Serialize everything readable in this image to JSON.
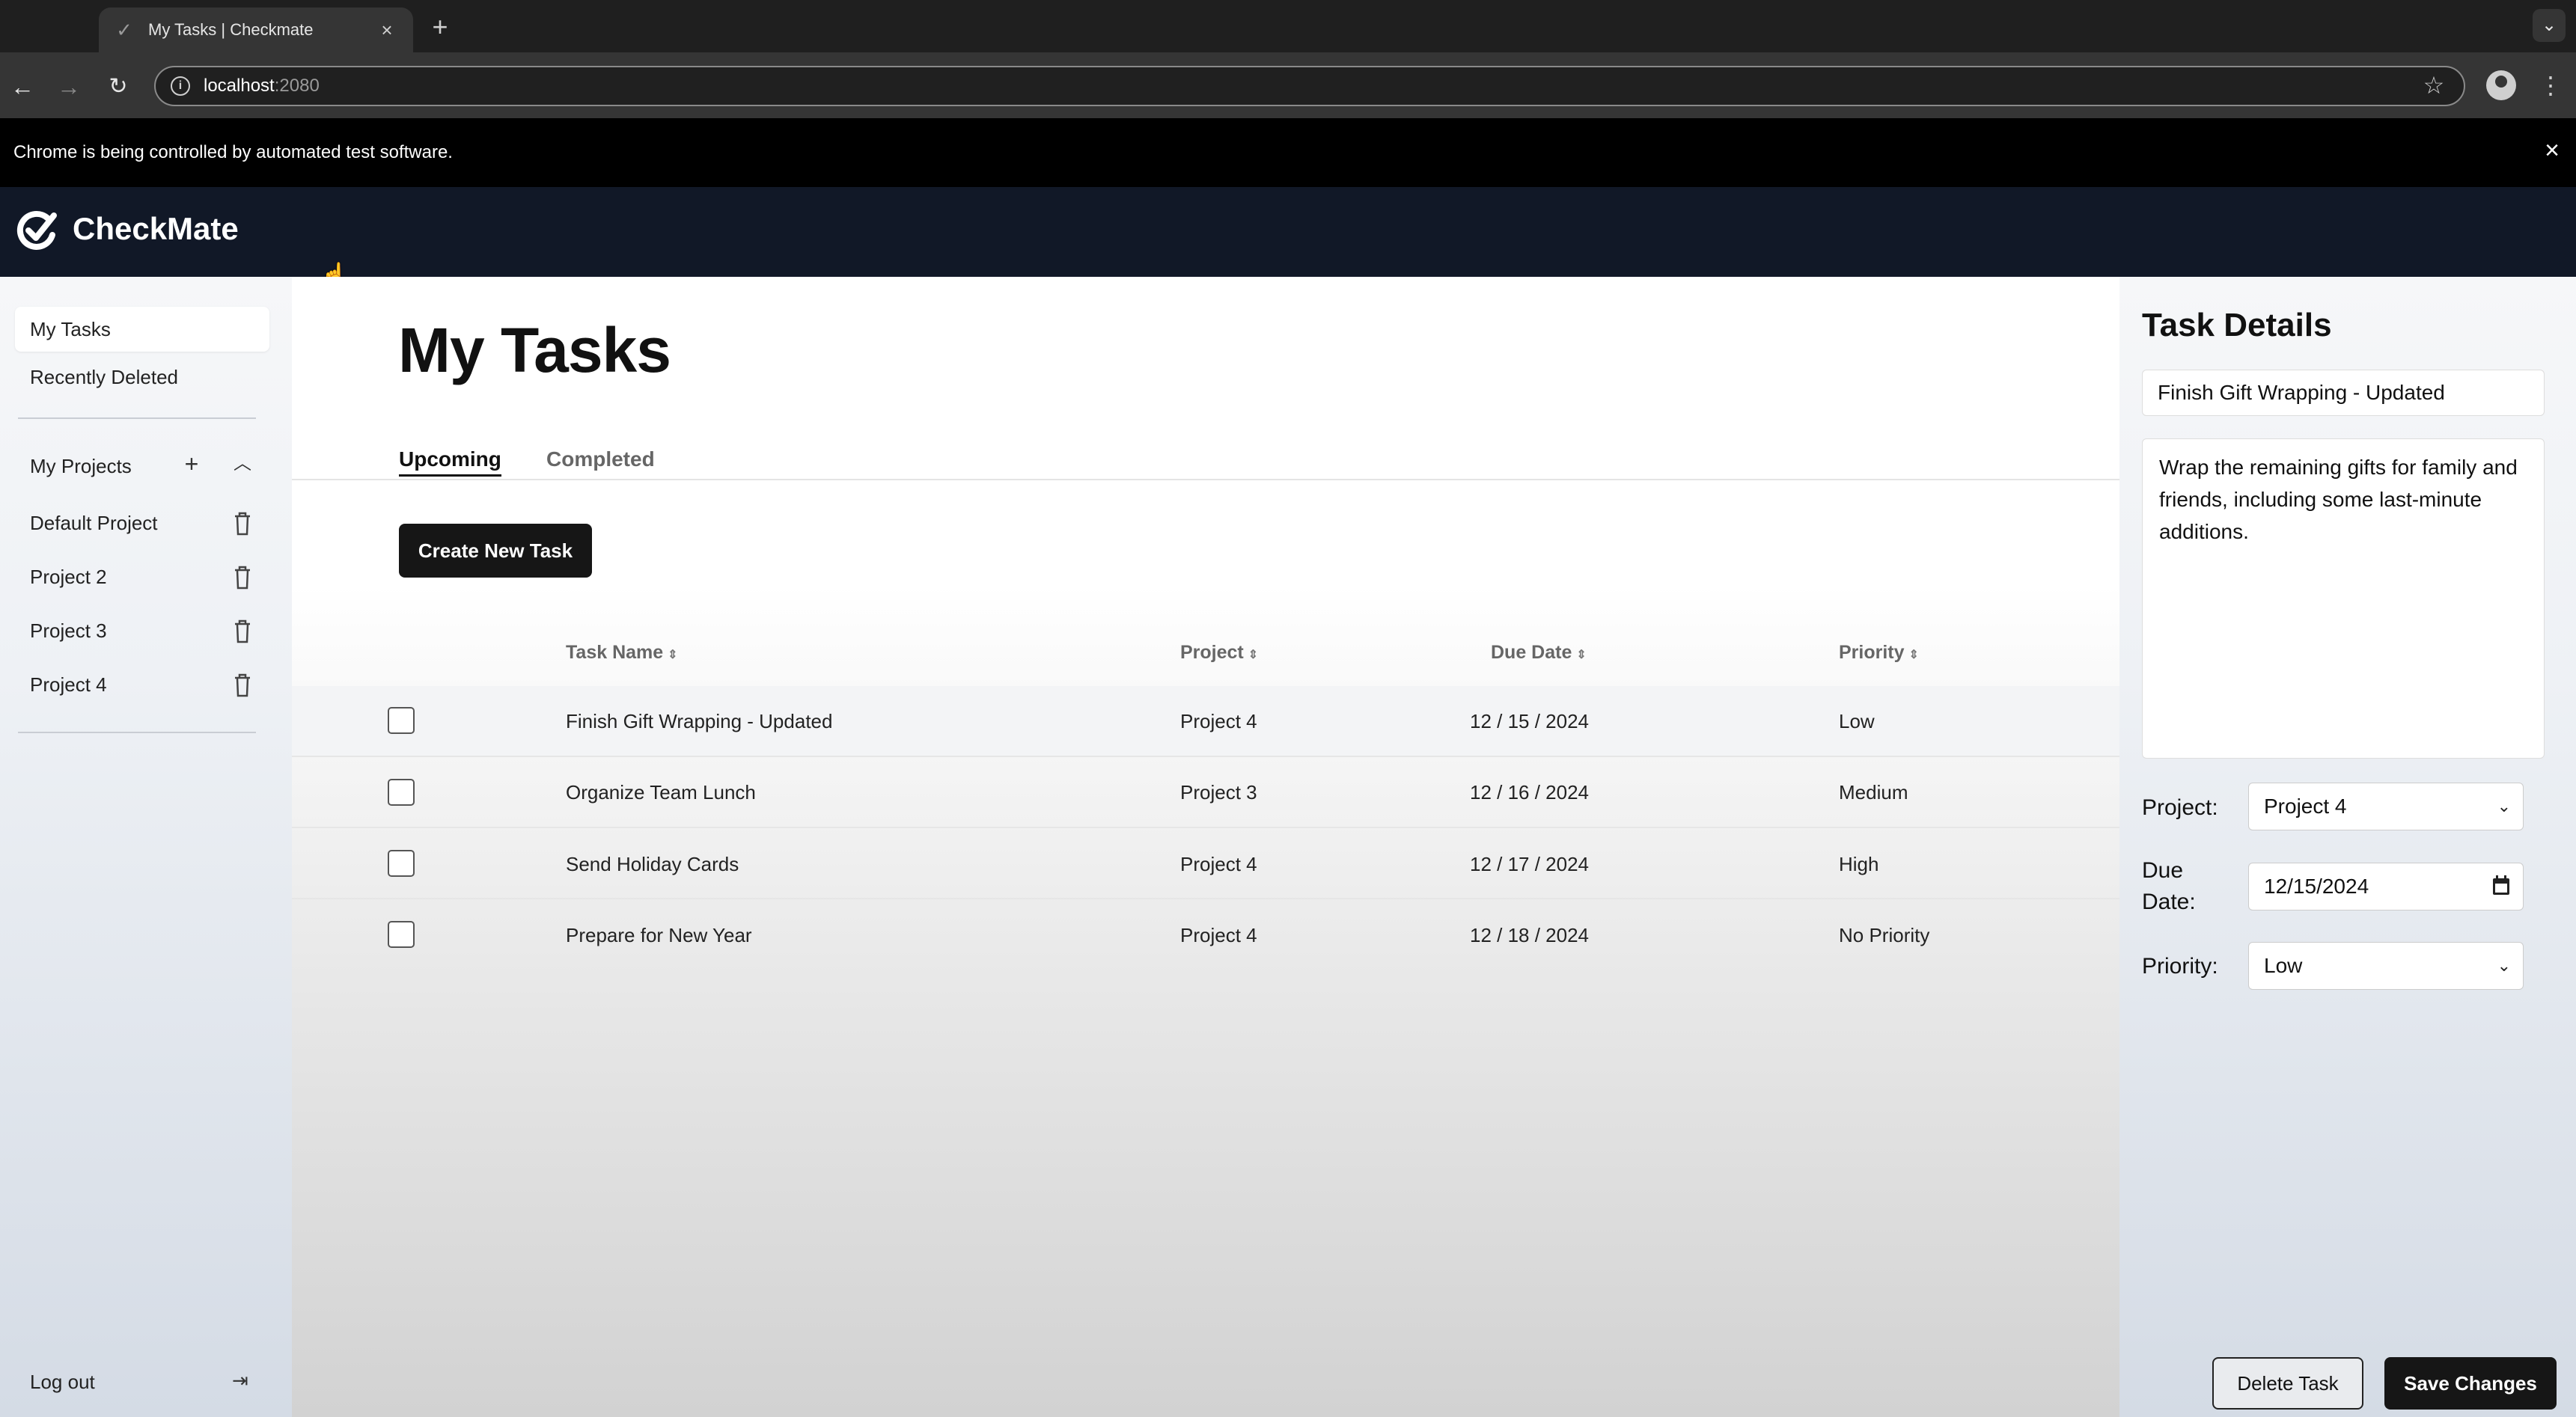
{
  "browser": {
    "tab_title": "My Tasks | Checkmate",
    "url_host": "localhost",
    "url_port": ":2080",
    "automation_notice": "Chrome is being controlled by automated test software."
  },
  "app": {
    "brand": "CheckMate"
  },
  "sidebar": {
    "nav": [
      {
        "label": "My Tasks"
      },
      {
        "label": "Recently Deleted"
      }
    ],
    "projects_heading": "My Projects",
    "projects": [
      {
        "label": "Default Project"
      },
      {
        "label": "Project 2"
      },
      {
        "label": "Project 3"
      },
      {
        "label": "Project 4"
      }
    ],
    "logout": "Log out"
  },
  "main": {
    "title": "My Tasks",
    "tabs": [
      {
        "label": "Upcoming"
      },
      {
        "label": "Completed"
      }
    ],
    "create_button": "Create New Task",
    "columns": [
      {
        "label": "Task Name"
      },
      {
        "label": "Project"
      },
      {
        "label": "Due Date"
      },
      {
        "label": "Priority"
      }
    ],
    "tasks": [
      {
        "name": "Finish Gift Wrapping - Updated",
        "project": "Project 4",
        "due": "12 / 15 / 2024",
        "priority": "Low"
      },
      {
        "name": "Organize Team Lunch",
        "project": "Project 3",
        "due": "12 / 16 / 2024",
        "priority": "Medium"
      },
      {
        "name": "Send Holiday Cards",
        "project": "Project 4",
        "due": "12 / 17 / 2024",
        "priority": "High"
      },
      {
        "name": "Prepare for New Year",
        "project": "Project 4",
        "due": "12 / 18 / 2024",
        "priority": "No Priority"
      }
    ]
  },
  "details": {
    "heading": "Task Details",
    "title_value": "Finish Gift Wrapping - Updated",
    "description": "Wrap the remaining gifts for family and friends, including some last-minute additions.",
    "project_label": "Project:",
    "project_value": "Project 4",
    "due_label_1": "Due",
    "due_label_2": "Date:",
    "due_value": "12/15/2024",
    "priority_label": "Priority:",
    "priority_value": "Low",
    "delete_button": "Delete Task",
    "save_button": "Save Changes"
  },
  "colors": {
    "header_bg": "#111827",
    "primary_button": "#161616",
    "selected_row": "#f3f4f6"
  }
}
